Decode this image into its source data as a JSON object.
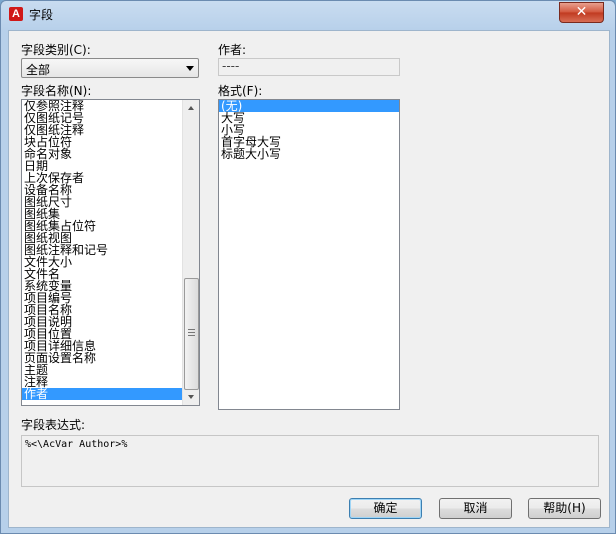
{
  "window": {
    "title": "字段",
    "app_icon_letter": "A",
    "close_label": "✕"
  },
  "category": {
    "label": "字段类别(C):",
    "value": "全部"
  },
  "field_names": {
    "label": "字段名称(N):",
    "items": [
      "仅参照注释",
      "仅图纸记号",
      "仅图纸注释",
      "块占位符",
      "命名对象",
      "日期",
      "上次保存者",
      "设备名称",
      "图纸尺寸",
      "图纸集",
      "图纸集占位符",
      "图纸视图",
      "图纸注释和记号",
      "文件大小",
      "文件名",
      "系统变量",
      "项目编号",
      "项目名称",
      "项目说明",
      "项目位置",
      "项目详细信息",
      "页面设置名称",
      "主题",
      "注释",
      "作者"
    ],
    "selected_index": 24
  },
  "author": {
    "label": "作者:",
    "value": "----"
  },
  "format": {
    "label": "格式(F):",
    "items": [
      "(无)",
      "大写",
      "小写",
      "首字母大写",
      "标题大小写"
    ],
    "selected_index": 0
  },
  "expression": {
    "label": "字段表达式:",
    "value": "%<\\AcVar Author>%"
  },
  "buttons": {
    "ok": "确定",
    "cancel": "取消",
    "help": "帮助(H)"
  }
}
